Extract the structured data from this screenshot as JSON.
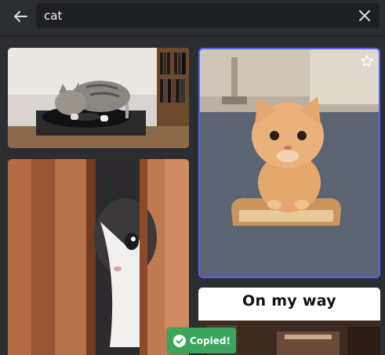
{
  "search": {
    "query": "cat",
    "back_icon": "arrow-left-icon",
    "clear_icon": "close-icon"
  },
  "results": [
    {
      "id": "dj-cat",
      "description_icon": "gif-thumbnail"
    },
    {
      "id": "bread-kitten",
      "favorite_icon": "star-outline-icon"
    },
    {
      "id": "peeking-cat"
    },
    {
      "id": "on-my-way",
      "caption": "On my way"
    }
  ],
  "toast": {
    "icon": "check-circle-icon",
    "text": "Copied!"
  },
  "colors": {
    "background": "#2b2d31",
    "input_bg": "#1e1f22",
    "selected_border": "#5865f2",
    "toast": "#3ba55d"
  }
}
